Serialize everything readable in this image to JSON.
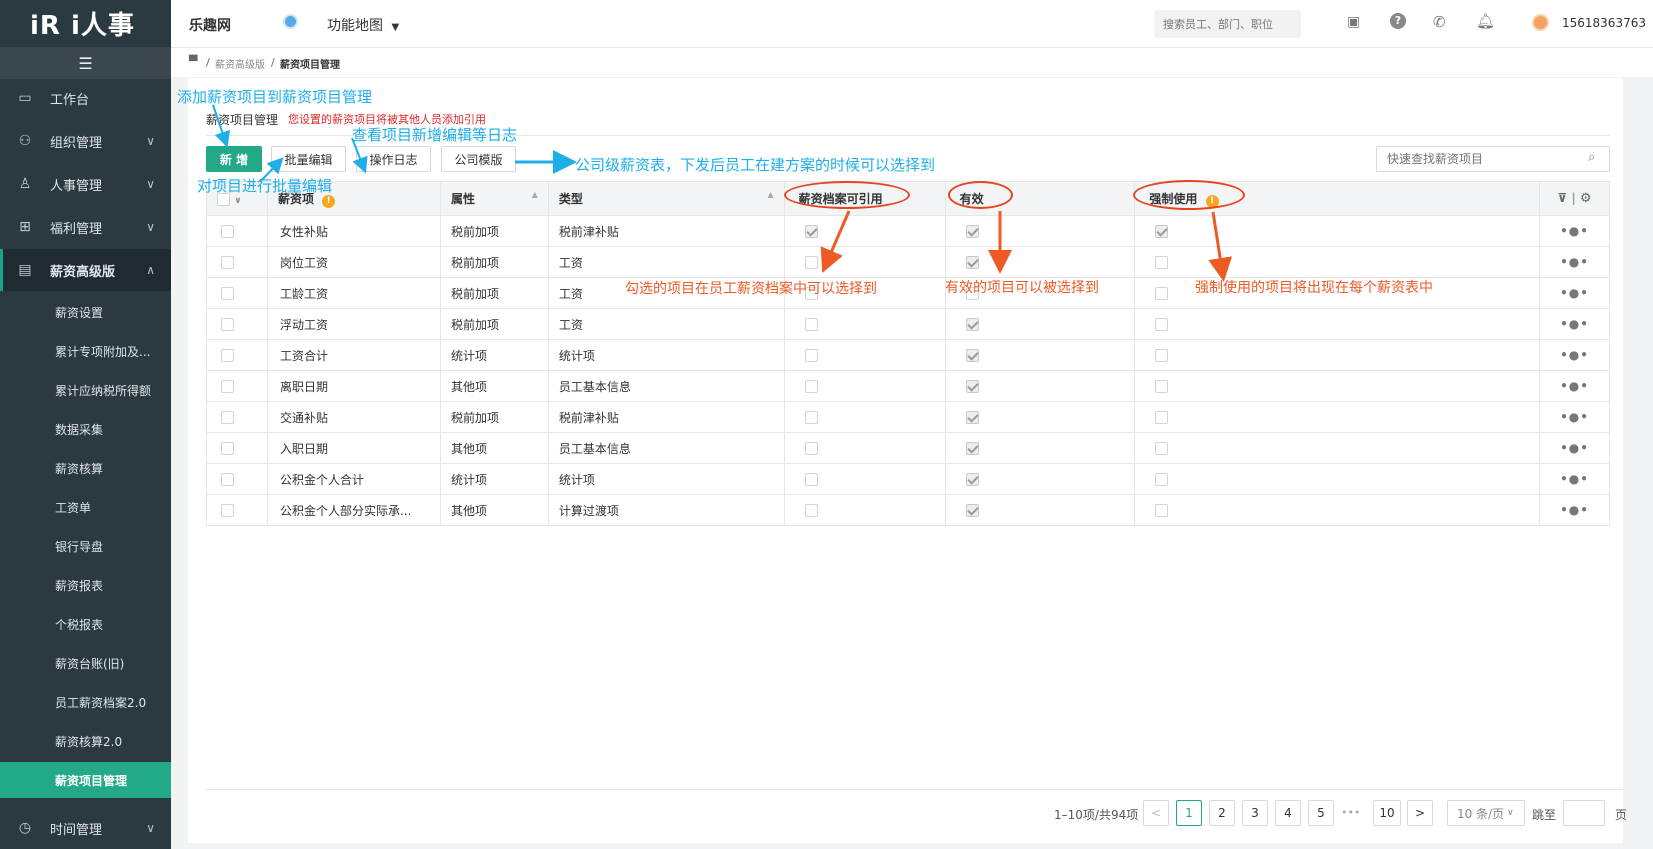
{
  "sidebar": {
    "logo": "iR i人事",
    "items": [
      {
        "label": "工作台",
        "icon": "monitor-icon"
      },
      {
        "label": "组织管理",
        "icon": "org-icon"
      },
      {
        "label": "人事管理",
        "icon": "person-icon"
      },
      {
        "label": "福利管理",
        "icon": "gift-icon"
      },
      {
        "label": "薪资高级版",
        "icon": "wallet-icon"
      },
      {
        "label": "时间管理",
        "icon": "clock-icon"
      }
    ],
    "subitems": [
      "薪资设置",
      "累计专项附加及...",
      "累计应纳税所得额",
      "数据采集",
      "薪资核算",
      "工资单",
      "银行导盘",
      "薪资报表",
      "个税报表",
      "薪资台账(旧)",
      "员工薪资档案2.0",
      "薪资核算2.0",
      "薪资项目管理"
    ]
  },
  "topbar": {
    "company": "乐趣网",
    "menu": "功能地图",
    "search_placeholder": "搜索员工、部门、职位",
    "phone": "15618363763"
  },
  "breadcrumb": {
    "parent": "薪资高级版",
    "current": "薪资项目管理"
  },
  "page": {
    "title": "薪资项目管理",
    "notice": "您设置的薪资项目将被其他人员添加引用",
    "buttons": {
      "add": "新 增",
      "batch_edit": "批量编辑",
      "log": "操作日志",
      "template": "公司模版"
    },
    "search_placeholder": "快速查找薪资项目"
  },
  "table": {
    "headers": [
      "薪资项",
      "属性",
      "类型",
      "薪资档案可引用",
      "有效",
      "强制使用"
    ],
    "rows": [
      {
        "name": "女性补贴",
        "attr": "税前加项",
        "type": "税前津补贴",
        "ref": true,
        "valid": true,
        "force": true
      },
      {
        "name": "岗位工资",
        "attr": "税前加项",
        "type": "工资",
        "ref": false,
        "valid": true,
        "force": false
      },
      {
        "name": "工龄工资",
        "attr": "税前加项",
        "type": "工资",
        "ref": false,
        "valid": false,
        "force": false
      },
      {
        "name": "浮动工资",
        "attr": "税前加项",
        "type": "工资",
        "ref": false,
        "valid": true,
        "force": false
      },
      {
        "name": "工资合计",
        "attr": "统计项",
        "type": "统计项",
        "ref": false,
        "valid": true,
        "force": false
      },
      {
        "name": "离职日期",
        "attr": "其他项",
        "type": "员工基本信息",
        "ref": false,
        "valid": true,
        "force": false
      },
      {
        "name": "交通补贴",
        "attr": "税前加项",
        "type": "税前津补贴",
        "ref": false,
        "valid": true,
        "force": false
      },
      {
        "name": "入职日期",
        "attr": "其他项",
        "type": "员工基本信息",
        "ref": false,
        "valid": true,
        "force": false
      },
      {
        "name": "公积金个人合计",
        "attr": "统计项",
        "type": "统计项",
        "ref": false,
        "valid": true,
        "force": false
      },
      {
        "name": "公积金个人部分实际承...",
        "attr": "其他项",
        "type": "计算过渡项",
        "ref": false,
        "valid": true,
        "force": false
      }
    ]
  },
  "pagination": {
    "summary": "1–10项/共94项",
    "pages": [
      "1",
      "2",
      "3",
      "4",
      "5"
    ],
    "ellipsis": "•••",
    "last": "10",
    "page_size": "10 条/页",
    "jump_label": "跳至",
    "page_unit": "页"
  },
  "annotations": {
    "add": "添加薪资项目到薪资项目管理",
    "log": "查看项目新增编辑等日志",
    "batch": "对项目进行批量编辑",
    "template": "公司级薪资表，下发后员工在建方案的时候可以选择到",
    "ref": "勾选的项目在员工薪资档案中可以选择到",
    "valid": "有效的项目可以被选择到",
    "force": "强制使用的项目将出现在每个薪资表中"
  },
  "colors": {
    "brand": "#23a888",
    "sidebar": "#2b3a40",
    "annotation_blue": "#1eaee9",
    "annotation_orange": "#ee5a24",
    "notice_red": "#e02828"
  }
}
